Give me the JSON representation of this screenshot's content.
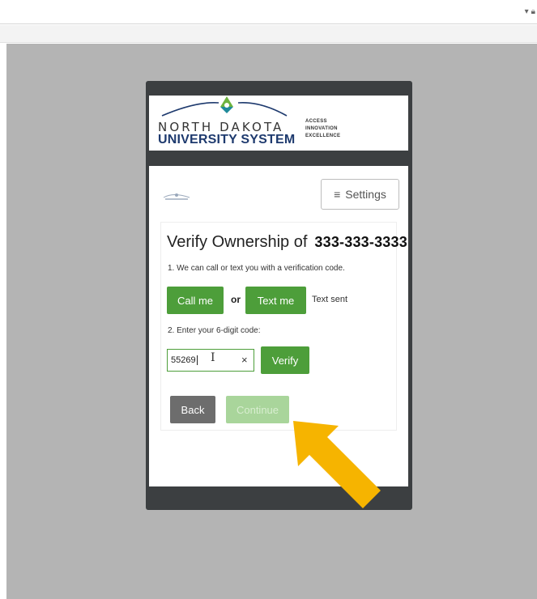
{
  "browser": {
    "dropdown_icon": "chevron-down-icon",
    "lock_icon": "lock-icon"
  },
  "brand": {
    "line1": "NORTH DAKOTA",
    "line2": "UNIVERSITY SYSTEM",
    "tagline": [
      "ACCESS",
      "INNOVATION",
      "EXCELLENCE"
    ],
    "colors": {
      "navy": "#1e3a6e",
      "green": "#6db33f",
      "teal": "#1f8a9a"
    }
  },
  "header": {
    "settings_label": "Settings",
    "settings_icon": "hamburger-icon"
  },
  "verify": {
    "title": "Verify Ownership of",
    "phone": "333-333-3333",
    "step1": "1. We can call or text you with a verification code.",
    "call_label": "Call me",
    "or_label": "or",
    "text_label": "Text me",
    "status": "Text sent",
    "step2": "2. Enter your 6-digit code:",
    "code_value": "55269",
    "clear_label": "×",
    "verify_label": "Verify",
    "back_label": "Back",
    "continue_label": "Continue"
  },
  "colors": {
    "primary_green": "#4d9e3a",
    "disabled_green": "#a9d59b",
    "back_gray": "#6d6d6d",
    "arrow": "#f6b400",
    "backdrop": "#b4b4b4",
    "frame": "#3c3f41"
  }
}
